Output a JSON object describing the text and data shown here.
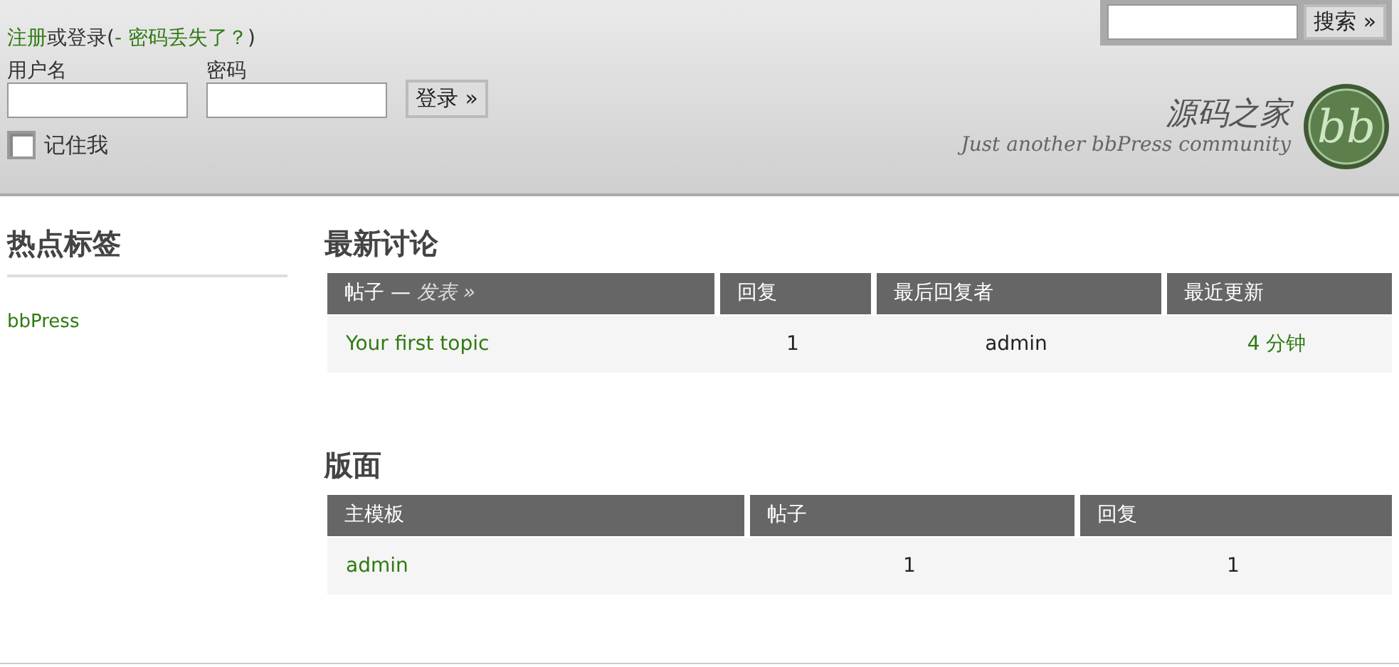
{
  "header": {
    "login_prompt": {
      "register_link": "注册",
      "middle": "或登录(",
      "lost_password_link": "- 密码丢失了？",
      "end": ")"
    },
    "username_label": "用户名",
    "password_label": "密码",
    "login_button": "登录 »",
    "remember_me": {
      "label": "记住我",
      "checked": false
    },
    "search_button": "搜索 »",
    "site_title": "源码之家",
    "tagline": "Just another bbPress community",
    "logo_mark": "bb"
  },
  "sidebar": {
    "title": "热点标签",
    "tags": [
      "bbPress"
    ]
  },
  "sections": [
    {
      "title": "最新讨论",
      "columns": [
        {
          "label": "帖子 —",
          "link": "发表 »"
        },
        {
          "label": "回复"
        },
        {
          "label": "最后回复者"
        },
        {
          "label": "最近更新"
        }
      ],
      "rows": [
        [
          {
            "kind": "link",
            "text": "Your first topic"
          },
          {
            "kind": "text",
            "text": "1"
          },
          {
            "kind": "text",
            "text": "admin"
          },
          {
            "kind": "link",
            "text": "4 分钟"
          }
        ]
      ]
    },
    {
      "title": "版面",
      "columns": [
        {
          "label": "主模板"
        },
        {
          "label": "帖子"
        },
        {
          "label": "回复"
        }
      ],
      "rows": [
        [
          {
            "kind": "link",
            "text": "admin"
          },
          {
            "kind": "text",
            "text": "1"
          },
          {
            "kind": "text",
            "text": "1"
          }
        ]
      ]
    }
  ]
}
